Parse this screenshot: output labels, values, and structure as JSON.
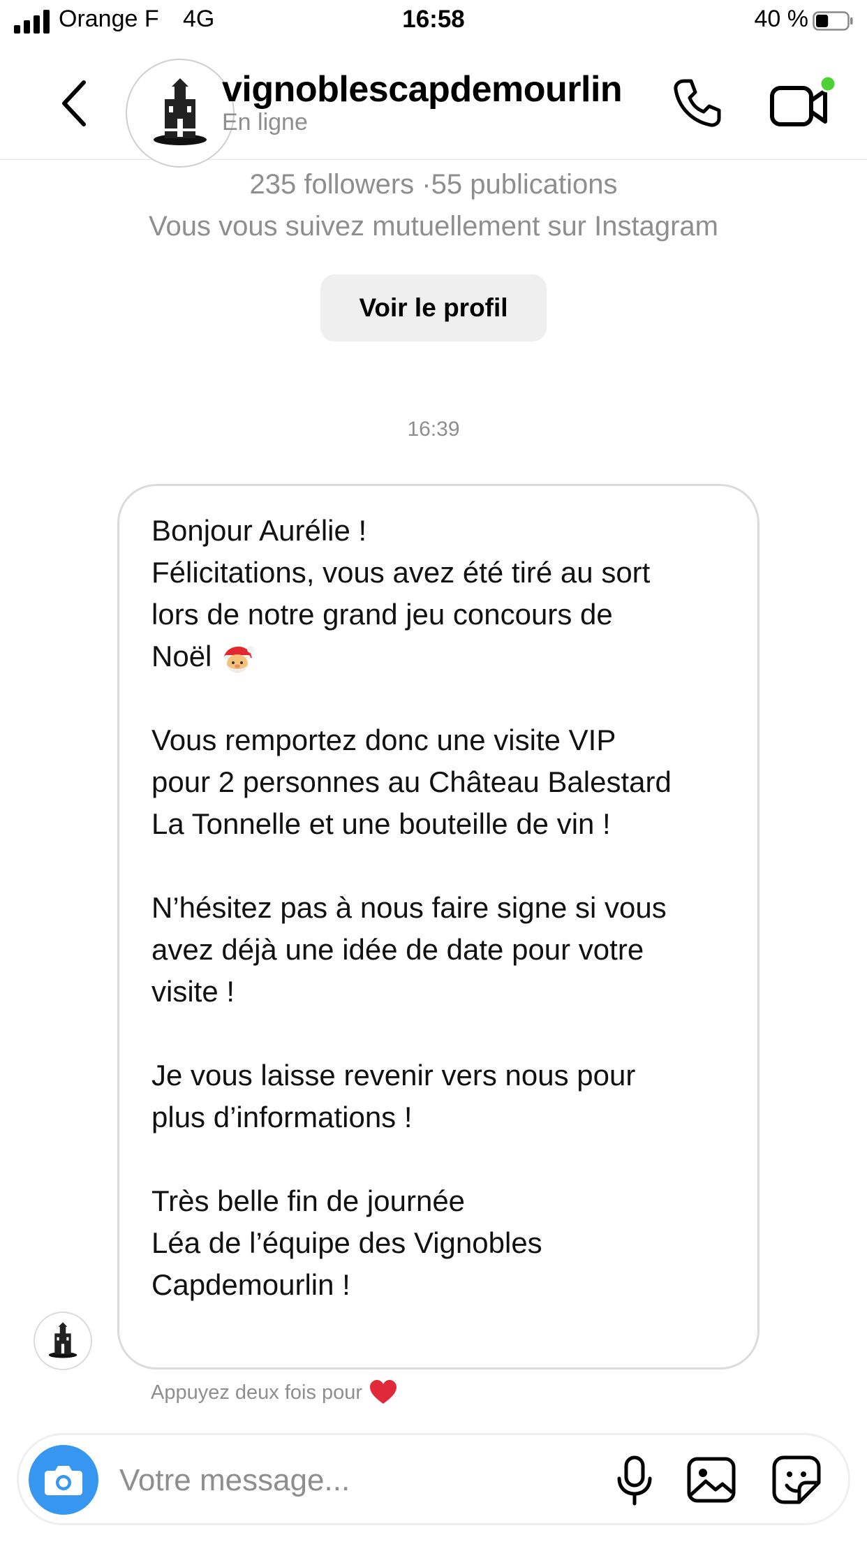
{
  "status_bar": {
    "carrier": "Orange F",
    "network": "4G",
    "time": "16:58",
    "battery_percent": "40 %",
    "battery_level": 0.4
  },
  "header": {
    "username": "vignoblescapdemourlin",
    "status": "En ligne",
    "online_dot_color": "#4cd137"
  },
  "profile_info": {
    "stats": "235 followers ·55 publications",
    "mutual": "Vous vous suivez mutuellement sur Instagram",
    "view_profile_label": "Voir le profil"
  },
  "conversation": {
    "timestamp": "16:39",
    "message_lines": [
      "Bonjour Aurélie !",
      "Félicitations, vous avez été tiré au sort",
      "lors de notre grand jeu concours de",
      "Noël",
      "",
      "Vous remportez donc une visite VIP",
      "pour 2 personnes au Château Balestard",
      "La Tonnelle et une bouteille de vin !",
      "",
      "N’hésitez pas à nous faire signe si vous",
      "avez déjà une idée de date pour votre",
      "visite !",
      "",
      "Je vous laisse revenir vers nous pour",
      "plus d’informations !",
      "",
      "Très belle fin de journée",
      "Léa de l’équipe des Vignobles",
      "Capdemourlin !"
    ],
    "like_hint": "Appuyez deux fois pour"
  },
  "composer": {
    "placeholder": "Votre message...",
    "accent_color": "#3797f0"
  },
  "icons": [
    "back-arrow-icon",
    "phone-icon",
    "video-call-icon",
    "camera-icon",
    "microphone-icon",
    "gallery-icon",
    "sticker-icon",
    "heart-icon",
    "santa-emoji-icon"
  ]
}
